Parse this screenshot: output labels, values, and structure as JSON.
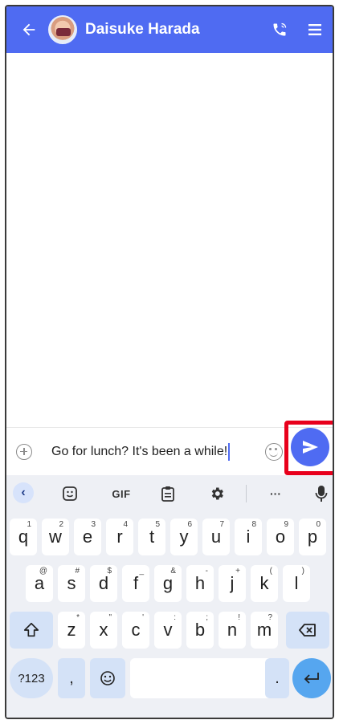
{
  "header": {
    "contact_name": "Daisuke Harada",
    "back_icon": "arrow-back-icon",
    "call_icon": "phone-icon",
    "menu_icon": "menu-icon",
    "background_color": "#4f6bf2"
  },
  "compose": {
    "message_text": "Go for lunch? It's been a while!",
    "send_icon": "send-icon",
    "highlight_color": "#e8001c"
  },
  "keyboard": {
    "toolbar": {
      "gif_label": "GIF",
      "more_label": "···"
    },
    "row1": [
      {
        "label": "q",
        "hint": "1"
      },
      {
        "label": "w",
        "hint": "2"
      },
      {
        "label": "e",
        "hint": "3"
      },
      {
        "label": "r",
        "hint": "4"
      },
      {
        "label": "t",
        "hint": "5"
      },
      {
        "label": "y",
        "hint": "6"
      },
      {
        "label": "u",
        "hint": "7"
      },
      {
        "label": "i",
        "hint": "8"
      },
      {
        "label": "o",
        "hint": "9"
      },
      {
        "label": "p",
        "hint": "0"
      }
    ],
    "row2": [
      {
        "label": "a",
        "hint": "@"
      },
      {
        "label": "s",
        "hint": "#"
      },
      {
        "label": "d",
        "hint": "$"
      },
      {
        "label": "f",
        "hint": "_"
      },
      {
        "label": "g",
        "hint": "&"
      },
      {
        "label": "h",
        "hint": "-"
      },
      {
        "label": "j",
        "hint": "+"
      },
      {
        "label": "k",
        "hint": "("
      },
      {
        "label": "l",
        "hint": ")"
      }
    ],
    "row3": [
      {
        "label": "z",
        "hint": "*"
      },
      {
        "label": "x",
        "hint": "\""
      },
      {
        "label": "c",
        "hint": "'"
      },
      {
        "label": "v",
        "hint": ":"
      },
      {
        "label": "b",
        "hint": ";"
      },
      {
        "label": "n",
        "hint": "!"
      },
      {
        "label": "m",
        "hint": "?"
      }
    ],
    "symbols_label": "?123",
    "comma_label": ",",
    "period_label": "."
  }
}
